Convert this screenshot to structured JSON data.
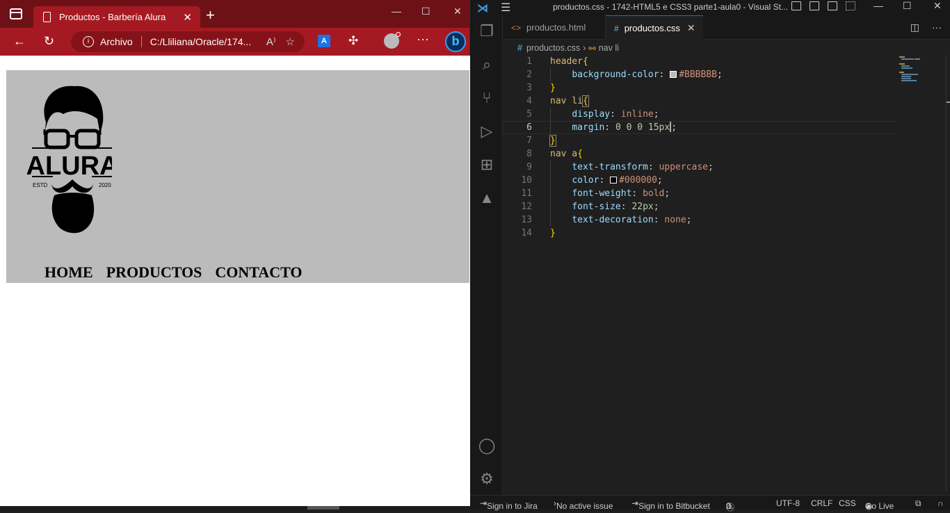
{
  "browser": {
    "tab_title": "Productos - Barbería Alura",
    "new_tab": "+",
    "window_controls": {
      "minimize": "—",
      "maximize": "☐",
      "close": "✕"
    },
    "address": {
      "scheme_label": "Archivo",
      "url": "C:/Lliliana/Oracle/174..."
    },
    "accent_color": "#a51a22",
    "titlebar_color": "#6e1117",
    "page": {
      "header_bg": "#BBBBBB",
      "logo": {
        "brand": "ALURA",
        "left_tag": "ESTD",
        "right_tag": "2020"
      },
      "nav": [
        "Home",
        "Productos",
        "Contacto"
      ]
    }
  },
  "vscode": {
    "window_title": "productos.css - 1742-HTML5 e CSS3 parte1-aula0 - Visual St...",
    "tabs": [
      {
        "label": "productos.html",
        "icon": "html-file-icon",
        "active": false
      },
      {
        "label": "productos.css",
        "icon": "css-file-icon",
        "active": true
      }
    ],
    "breadcrumb": {
      "file": "productos.css",
      "symbol": "nav li"
    },
    "current_line": 6,
    "code_lines": [
      "header{",
      "    background-color: #BBBBBB;",
      "}",
      "nav li{",
      "    display: inline;",
      "    margin: 0 0 0 15px;",
      "}",
      "nav a{",
      "    text-transform: uppercase;",
      "    color: #000000;",
      "    font-weight: bold;",
      "    font-size: 22px;",
      "    text-decoration: none;",
      "}"
    ],
    "tokens": {
      "l1_sel": "header",
      "l2_prop": "background-color",
      "l2_val": "#BBBBBB",
      "l4_sel": "nav li",
      "l5_prop": "display",
      "l5_val": "inline",
      "l6_prop": "margin",
      "l6_val": "0 0 0 15px",
      "l8_sel": "nav a",
      "l9_prop": "text-transform",
      "l9_val": "uppercase",
      "l10_prop": "color",
      "l10_val": "#000000",
      "l11_prop": "font-weight",
      "l11_val": "bold",
      "l12_prop": "font-size",
      "l12_val": "22px",
      "l13_prop": "text-decoration",
      "l13_val": "none"
    },
    "line_numbers": [
      "1",
      "2",
      "3",
      "4",
      "5",
      "6",
      "7",
      "8",
      "9",
      "10",
      "11",
      "12",
      "13",
      "14"
    ],
    "status_bar": {
      "jira": "Sign in to Jira",
      "issue": "No active issue",
      "bitbucket": "Sign in to Bitbucket",
      "errors": "0",
      "warnings": "0",
      "encoding": "UTF-8",
      "eol": "CRLF",
      "language": "CSS",
      "go_live": "Go Live"
    }
  }
}
